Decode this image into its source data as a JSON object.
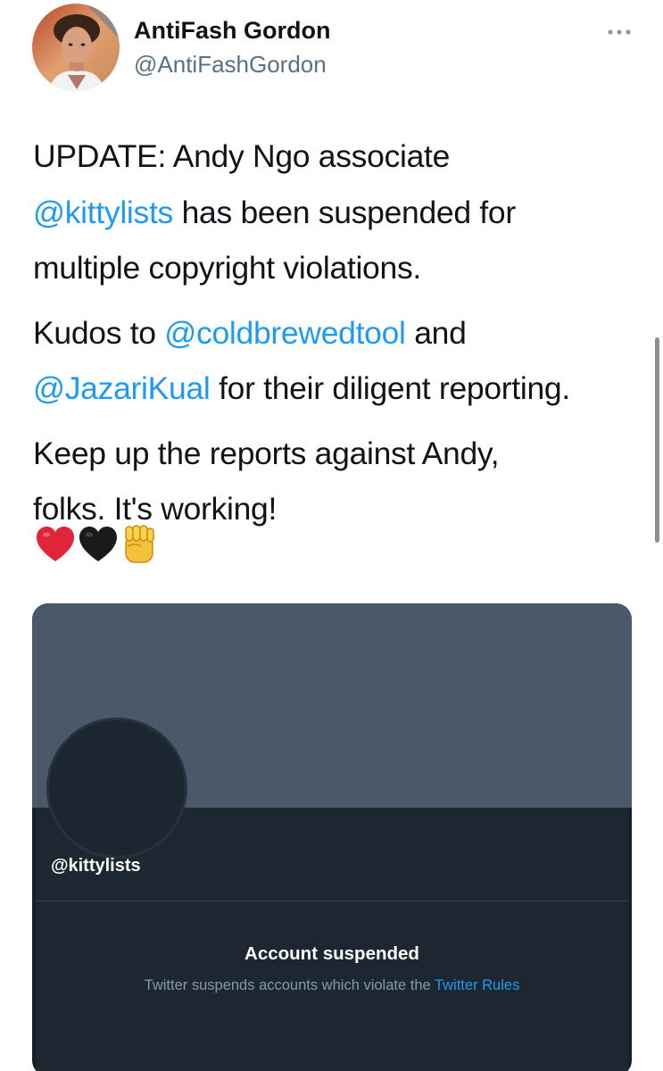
{
  "author": {
    "display_name": "AntiFash Gordon",
    "handle": "@AntiFashGordon"
  },
  "tweet": {
    "p1_a": "UPDATE: Andy Ngo associate",
    "p1_mention": "@kittylists",
    "p1_b": " has been suspended for",
    "p1_c": "multiple copyright violations.",
    "p2_a": "Kudos to ",
    "p2_mention1": "@coldbrewedtool",
    "p2_b": " and",
    "p2_mention2": "@JazariKual",
    "p2_c": " for their diligent reporting.",
    "p3_a": "Keep up the reports against Andy,",
    "p3_b": "folks. It's working!",
    "emojis": [
      "red-heart-icon",
      "black-heart-icon",
      "raised-fist-icon"
    ]
  },
  "embed": {
    "handle": "@kittylists",
    "title": "Account suspended",
    "subtitle_prefix": "Twitter suspends accounts which violate the ",
    "subtitle_link": "Twitter Rules"
  },
  "colors": {
    "mention": "#1d9bf0",
    "banner": "#4a5969",
    "card_bg": "#1c2732",
    "secondary_text": "#5b7083"
  }
}
